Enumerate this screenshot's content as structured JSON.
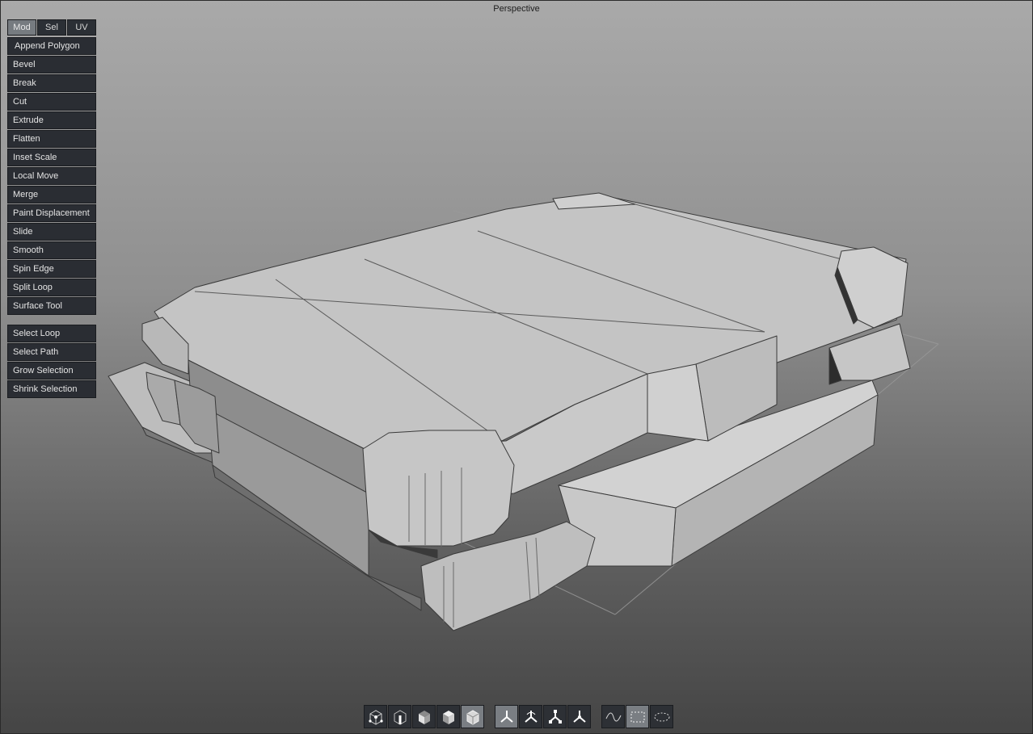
{
  "viewport": {
    "title": "Perspective"
  },
  "tabs": [
    {
      "label": "Mod",
      "active": true
    },
    {
      "label": "Sel",
      "active": false
    },
    {
      "label": "UV",
      "active": false
    }
  ],
  "modeling_tools": [
    "Append Polygon",
    "Bevel",
    "Break",
    "Cut",
    "Extrude",
    "Flatten",
    "Inset Scale",
    "Local Move",
    "Merge",
    "Paint Displacement",
    "Slide",
    "Smooth",
    "Spin Edge",
    "Split Loop",
    "Surface Tool"
  ],
  "selection_tools": [
    "Select Loop",
    "Select Path",
    "Grow Selection",
    "Shrink Selection"
  ],
  "toolbar": {
    "component_modes": [
      {
        "icon": "vertex-mode-icon",
        "active": false
      },
      {
        "icon": "edge-mode-icon",
        "active": false
      },
      {
        "icon": "face-mode-icon",
        "active": false
      },
      {
        "icon": "uv-mode-icon",
        "active": false
      },
      {
        "icon": "object-mode-icon",
        "active": true
      }
    ],
    "transform_modes": [
      {
        "icon": "move-icon",
        "active": true
      },
      {
        "icon": "rotate-icon",
        "active": false
      },
      {
        "icon": "scale-icon",
        "active": false
      },
      {
        "icon": "universal-icon",
        "active": false
      }
    ],
    "selection_modes": [
      {
        "icon": "lasso-select-icon",
        "active": false
      },
      {
        "icon": "rectangle-select-icon",
        "active": true
      },
      {
        "icon": "paint-select-icon",
        "active": false
      }
    ]
  }
}
